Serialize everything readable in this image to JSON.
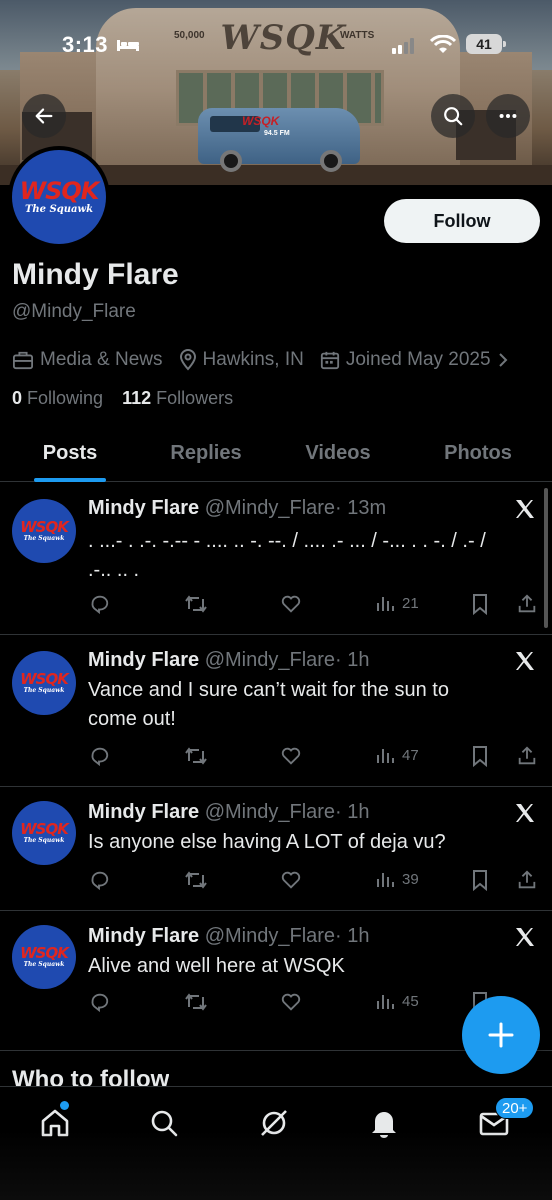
{
  "status_bar": {
    "time": "3:13",
    "battery": "41"
  },
  "banner": {
    "sign_text": "WSQK",
    "sign_left": "50,000",
    "sign_right": "WATTS",
    "van_logo": "WSQK",
    "van_sub": "94.5 FM"
  },
  "header": {
    "back_icon": "back-arrow-icon",
    "search_icon": "search-icon",
    "more_icon": "more-icon"
  },
  "avatar": {
    "logo_main": "WSQK",
    "logo_sub": "The Squawk",
    "colors": {
      "disc": "#1f4ab0",
      "logo_text": "#e0261f"
    }
  },
  "profile": {
    "follow_label": "Follow",
    "display_name": "Mindy Flare",
    "handle": "@Mindy_Flare",
    "category": "Media & News",
    "location": "Hawkins, IN",
    "joined": "Joined May 2025",
    "following_count": "0",
    "following_label": "Following",
    "followers_count": "112",
    "followers_label": "Followers"
  },
  "tabs": [
    {
      "label": "Posts",
      "active": true
    },
    {
      "label": "Replies",
      "active": false
    },
    {
      "label": "Videos",
      "active": false
    },
    {
      "label": "Photos",
      "active": false
    }
  ],
  "posts": [
    {
      "name": "Mindy Flare",
      "handle": "@Mindy_Flare",
      "time": "· 13m",
      "text": ". ...- . .-. -.-- - .... .. -. --. / .... .- ... / -... . . -. / .- / .-.. .. .",
      "views": "21"
    },
    {
      "name": "Mindy Flare",
      "handle": "@Mindy_Flare",
      "time": "· 1h",
      "text": "Vance and I sure can’t wait for the sun to come out!",
      "views": "47"
    },
    {
      "name": "Mindy Flare",
      "handle": "@Mindy_Flare",
      "time": "· 1h",
      "text": "Is anyone else having A LOT of deja vu?",
      "views": "39"
    },
    {
      "name": "Mindy Flare",
      "handle": "@Mindy_Flare",
      "time": "· 1h",
      "text": "Alive and well here at WSQK",
      "views": "45"
    }
  ],
  "who_to_follow": "Who to follow",
  "nav": {
    "messages_badge": "20+"
  },
  "colors": {
    "accent": "#1d9bf0",
    "text": "#e7e9ea",
    "muted": "#71767b",
    "background": "#000000"
  }
}
